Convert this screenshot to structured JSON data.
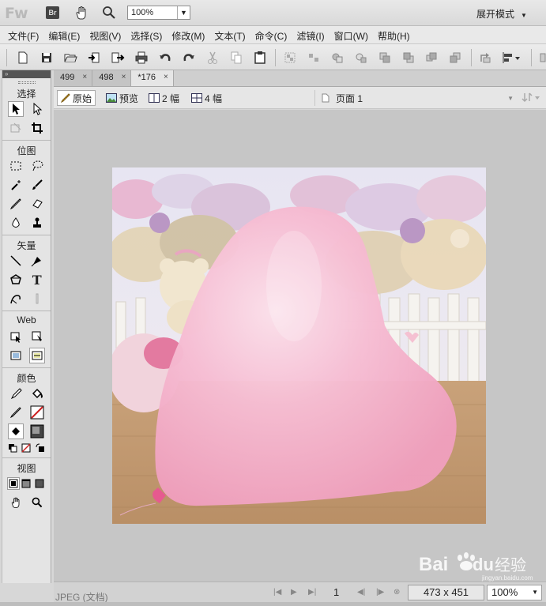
{
  "app": {
    "logo": "Fw",
    "bridge_label": "Br",
    "zoom_value": "100%",
    "workspace_mode": "展开模式"
  },
  "menu": [
    "文件(F)",
    "编辑(E)",
    "视图(V)",
    "选择(S)",
    "修改(M)",
    "文本(T)",
    "命令(C)",
    "滤镜(I)",
    "窗口(W)",
    "帮助(H)"
  ],
  "tools": {
    "panel_toggle": "»",
    "sections": {
      "select": "选择",
      "bitmap": "位图",
      "vector": "矢量",
      "web": "Web",
      "colors": "颜色",
      "view": "视图"
    },
    "text_tool": "T"
  },
  "document": {
    "tabs": [
      {
        "label": "499",
        "close": "×"
      },
      {
        "label": "498",
        "close": "×"
      },
      {
        "label": "*176",
        "close": "×"
      }
    ],
    "views": {
      "original": "原始",
      "preview": "预览",
      "two_up": "2 幅",
      "four_up": "4 幅"
    },
    "page": "页面 1"
  },
  "status": {
    "file_type": "JPEG (文档)",
    "page_number": "1",
    "dimensions": "473 x 451",
    "zoom": "100%"
  },
  "watermark": {
    "brand": "Bai",
    "brand_suffix": "du",
    "cn": "经验",
    "url": "jingyan.baidu.com"
  },
  "colors": {
    "balloon": "#f6b6cf",
    "accent_pink": "#e65a8f",
    "stroke_red": "#cc2222"
  }
}
